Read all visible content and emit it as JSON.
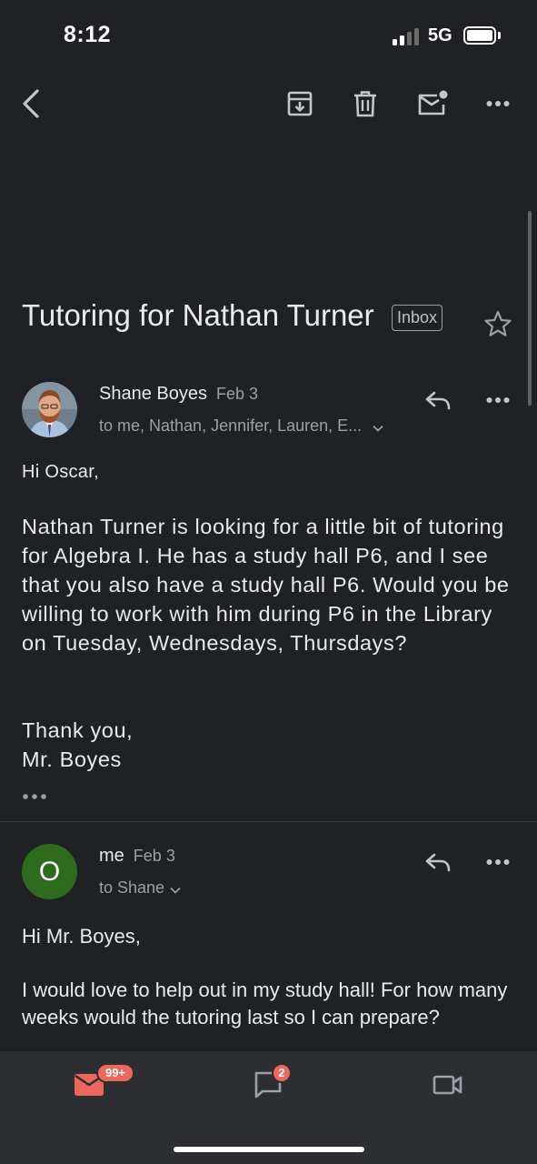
{
  "status_bar": {
    "time": "8:12",
    "network": "5G"
  },
  "subject": {
    "title": "Tutoring for Nathan Turner",
    "label": "Inbox"
  },
  "messages": [
    {
      "sender": "Shane Boyes",
      "date": "Feb 3",
      "recipients": "to me, Nathan, Jennifer, Lauren, E...",
      "greeting": "Hi Oscar,",
      "body": "Nathan Turner is looking for a little bit of tutoring for Algebra I. He has a study hall P6, and I see that you also have a study hall P6. Would you be willing to work with him during P6 in the Library on Tuesday, Wednesdays, Thursdays?",
      "closing_1": "Thank you,",
      "closing_2": "Mr. Boyes"
    },
    {
      "sender": "me",
      "avatar_letter": "O",
      "date": "Feb 3",
      "recipients": "to Shane",
      "greeting": "Hi Mr. Boyes,",
      "body": "I would love to help out in my study hall! For how many weeks would the tutoring last so I can prepare?"
    }
  ],
  "bottom_nav": {
    "mail_badge": "99+",
    "chat_badge": "2"
  },
  "colors": {
    "background": "#202124",
    "nav_background": "#2d2e31",
    "badge": "#ee675c",
    "avatar_green": "#2e6b1f",
    "mail_active": "#ee675c"
  }
}
